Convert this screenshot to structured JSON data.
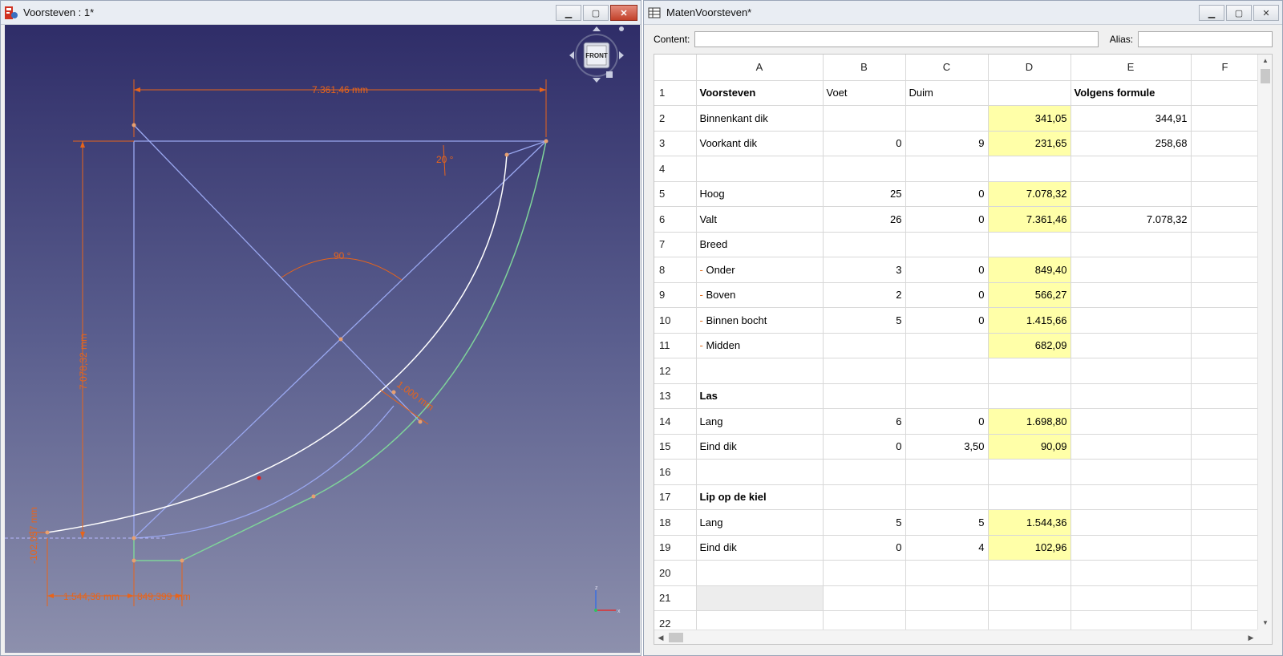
{
  "left_window": {
    "title": "Voorsteven : 1*",
    "viewport": {
      "dimensions": {
        "top_width": "7.361,46 mm",
        "left_height": "7.078,32 mm",
        "bottom_left": "1.544,36 mm",
        "bottom_right": "849,399 mm",
        "left_small": "-102,957 mm",
        "diag": "1.000 mm",
        "angle_small": "20 °",
        "angle_mid": "90 °"
      },
      "navcube_face": "FRONT",
      "axis": {
        "x": "x",
        "z": "z"
      }
    }
  },
  "right_window": {
    "title": "MatenVoorsteven*",
    "content_label": "Content:",
    "alias_label": "Alias:",
    "content_value": "",
    "alias_value": "",
    "columns": [
      "A",
      "B",
      "C",
      "D",
      "E",
      "F"
    ],
    "rows": [
      {
        "n": "1",
        "A": "Voorsteven",
        "B": "Voet",
        "C": "Duim",
        "D": "",
        "E": "Volgens formule",
        "boldA": true,
        "boldE": true
      },
      {
        "n": "2",
        "A": "Binnenkant dik",
        "B": "",
        "C": "",
        "D": "341,05",
        "E": "344,91"
      },
      {
        "n": "3",
        "A": "Voorkant dik",
        "B": "0",
        "C": "9",
        "D": "231,65",
        "E": "258,68"
      },
      {
        "n": "4",
        "A": "",
        "B": "",
        "C": "",
        "D": "",
        "E": ""
      },
      {
        "n": "5",
        "A": "Hoog",
        "B": "25",
        "C": "0",
        "D": "7.078,32",
        "E": ""
      },
      {
        "n": "6",
        "A": "Valt",
        "B": "26",
        "C": "0",
        "D": "7.361,46",
        "E": "7.078,32"
      },
      {
        "n": "7",
        "A": "Breed",
        "B": "",
        "C": "",
        "D": "",
        "E": ""
      },
      {
        "n": "8",
        "A": "Onder",
        "dash": "-",
        "B": "3",
        "C": "0",
        "D": "849,40",
        "E": ""
      },
      {
        "n": "9",
        "A": "Boven",
        "dash": "-",
        "B": "2",
        "C": "0",
        "D": "566,27",
        "E": ""
      },
      {
        "n": "10",
        "A": "Binnen bocht",
        "dash": "-",
        "B": "5",
        "C": "0",
        "D": "1.415,66",
        "E": ""
      },
      {
        "n": "11",
        "A": "Midden",
        "dash": "-",
        "B": "",
        "C": "",
        "D": "682,09",
        "E": ""
      },
      {
        "n": "12",
        "A": "",
        "B": "",
        "C": "",
        "D": "",
        "E": ""
      },
      {
        "n": "13",
        "A": "Las",
        "B": "",
        "C": "",
        "D": "",
        "E": "",
        "boldA": true
      },
      {
        "n": "14",
        "A": "Lang",
        "B": "6",
        "C": "0",
        "D": "1.698,80",
        "E": ""
      },
      {
        "n": "15",
        "A": "Eind dik",
        "B": "0",
        "C": "3,50",
        "D": "90,09",
        "E": ""
      },
      {
        "n": "16",
        "A": "",
        "B": "",
        "C": "",
        "D": "",
        "E": ""
      },
      {
        "n": "17",
        "A": "Lip op de kiel",
        "B": "",
        "C": "",
        "D": "",
        "E": "",
        "boldA": true
      },
      {
        "n": "18",
        "A": "Lang",
        "B": "5",
        "C": "5",
        "D": "1.544,36",
        "E": ""
      },
      {
        "n": "19",
        "A": "Eind dik",
        "B": "0",
        "C": "4",
        "D": "102,96",
        "E": ""
      },
      {
        "n": "20",
        "A": "",
        "B": "",
        "C": "",
        "D": "",
        "E": ""
      },
      {
        "n": "21",
        "A": "",
        "B": "",
        "C": "",
        "D": "",
        "E": "",
        "selA": true
      },
      {
        "n": "22",
        "A": "",
        "B": "",
        "C": "",
        "D": "",
        "E": ""
      }
    ],
    "highlight_color": "#ffffa8"
  },
  "colors": {
    "dimension": "#e8641a",
    "construction": "#9aa8f0",
    "curve": "#ffffff",
    "green": "#7fd39a"
  }
}
